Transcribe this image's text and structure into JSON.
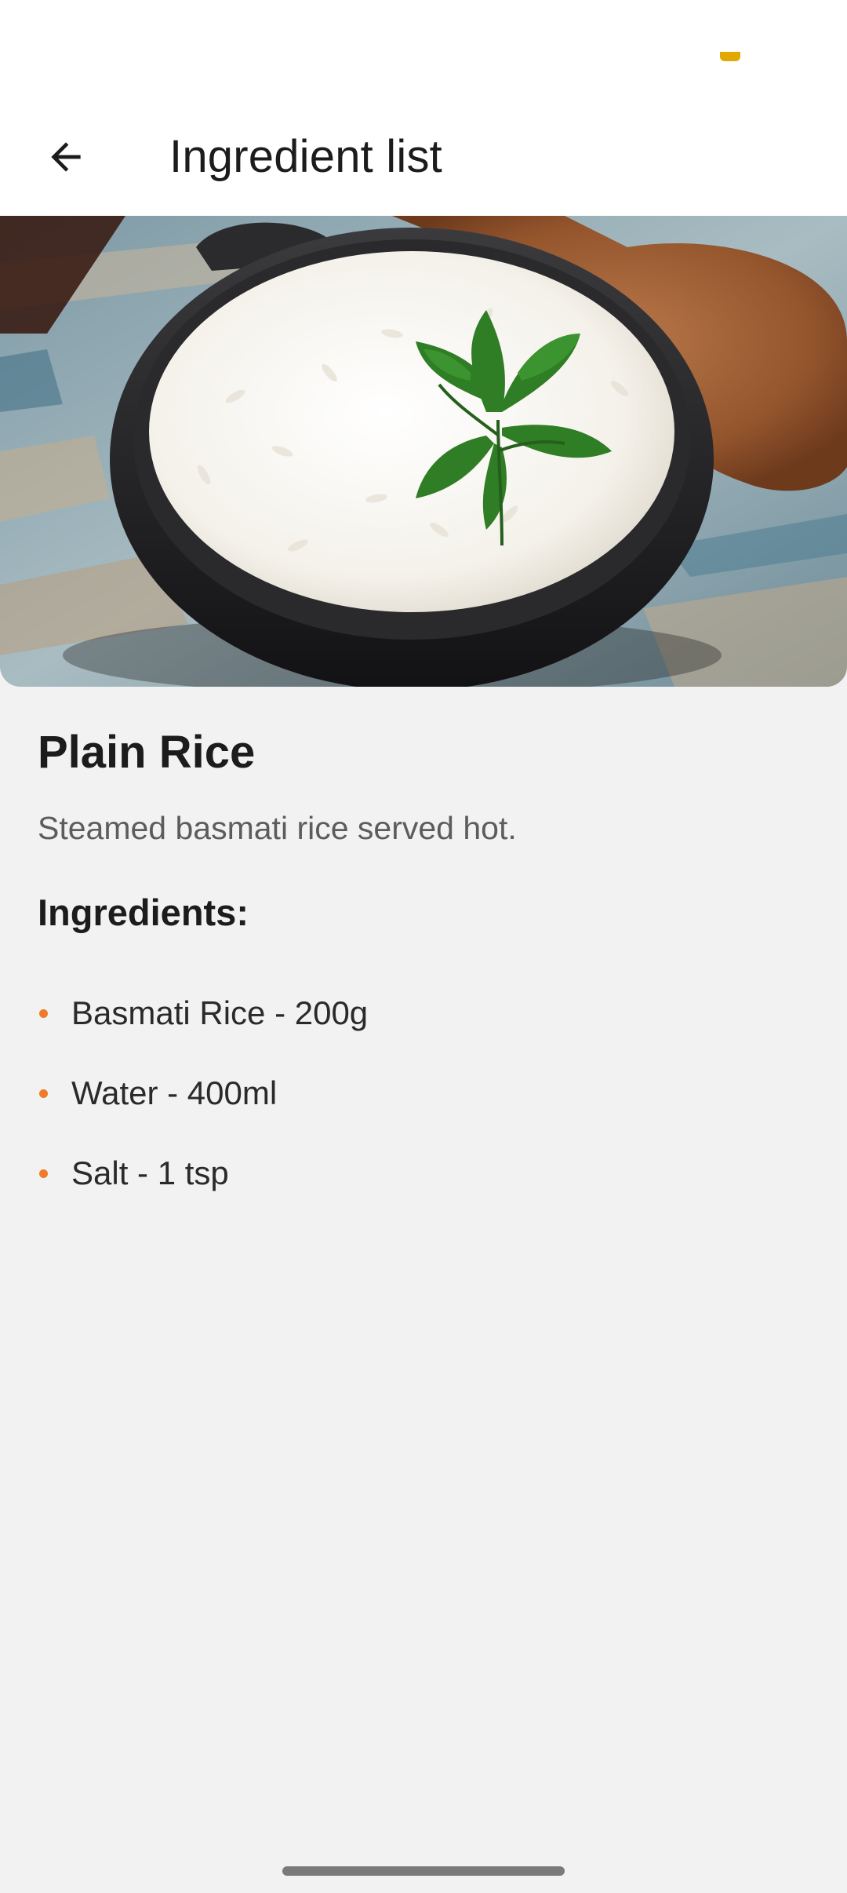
{
  "app_bar": {
    "title": "Ingredient list",
    "back_icon": "arrow-left-icon"
  },
  "recipe": {
    "name": "Plain Rice",
    "description": "Steamed basmati rice served hot.",
    "image": "bowl of steamed white rice with parsley garnish on wooden table"
  },
  "ingredients": {
    "heading": "Ingredients:",
    "items": [
      "Basmati Rice - 200g",
      "Water - 400ml",
      "Salt - 1 tsp"
    ]
  },
  "colors": {
    "accent": "#f07a2a",
    "background": "#f2f2f2",
    "surface": "#ffffff",
    "status_indicator": "#e0a800"
  }
}
